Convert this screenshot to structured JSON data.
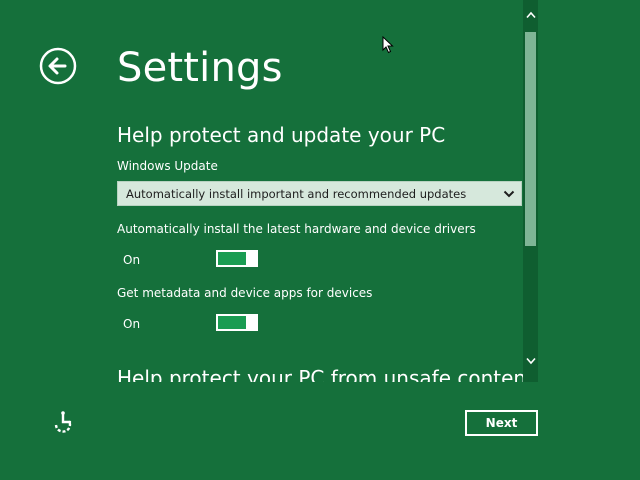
{
  "page": {
    "title": "Settings"
  },
  "section_update": {
    "heading": "Help protect and update your PC",
    "windows_update_label": "Windows Update",
    "windows_update_value": "Automatically install important and recommended updates",
    "drivers_label": "Automatically install the latest hardware and device drivers",
    "drivers_state": "On",
    "metadata_label": "Get metadata and device apps for devices",
    "metadata_state": "On"
  },
  "section_unsafe": {
    "heading": "Help protect your PC from unsafe content"
  },
  "footer": {
    "next_label": "Next"
  },
  "icons": {
    "back": "back-arrow-icon",
    "ease_of_access": "ease-of-access-icon",
    "dropdown": "chevron-down-icon",
    "scroll_up": "chevron-up-icon",
    "scroll_down": "chevron-down-icon",
    "cursor": "mouse-pointer-icon"
  },
  "colors": {
    "background": "#15703b",
    "dropdown_background": "#d6e8dc",
    "toggle_on": "#1a9c52",
    "scrollbar_thumb": "#7fb596"
  }
}
